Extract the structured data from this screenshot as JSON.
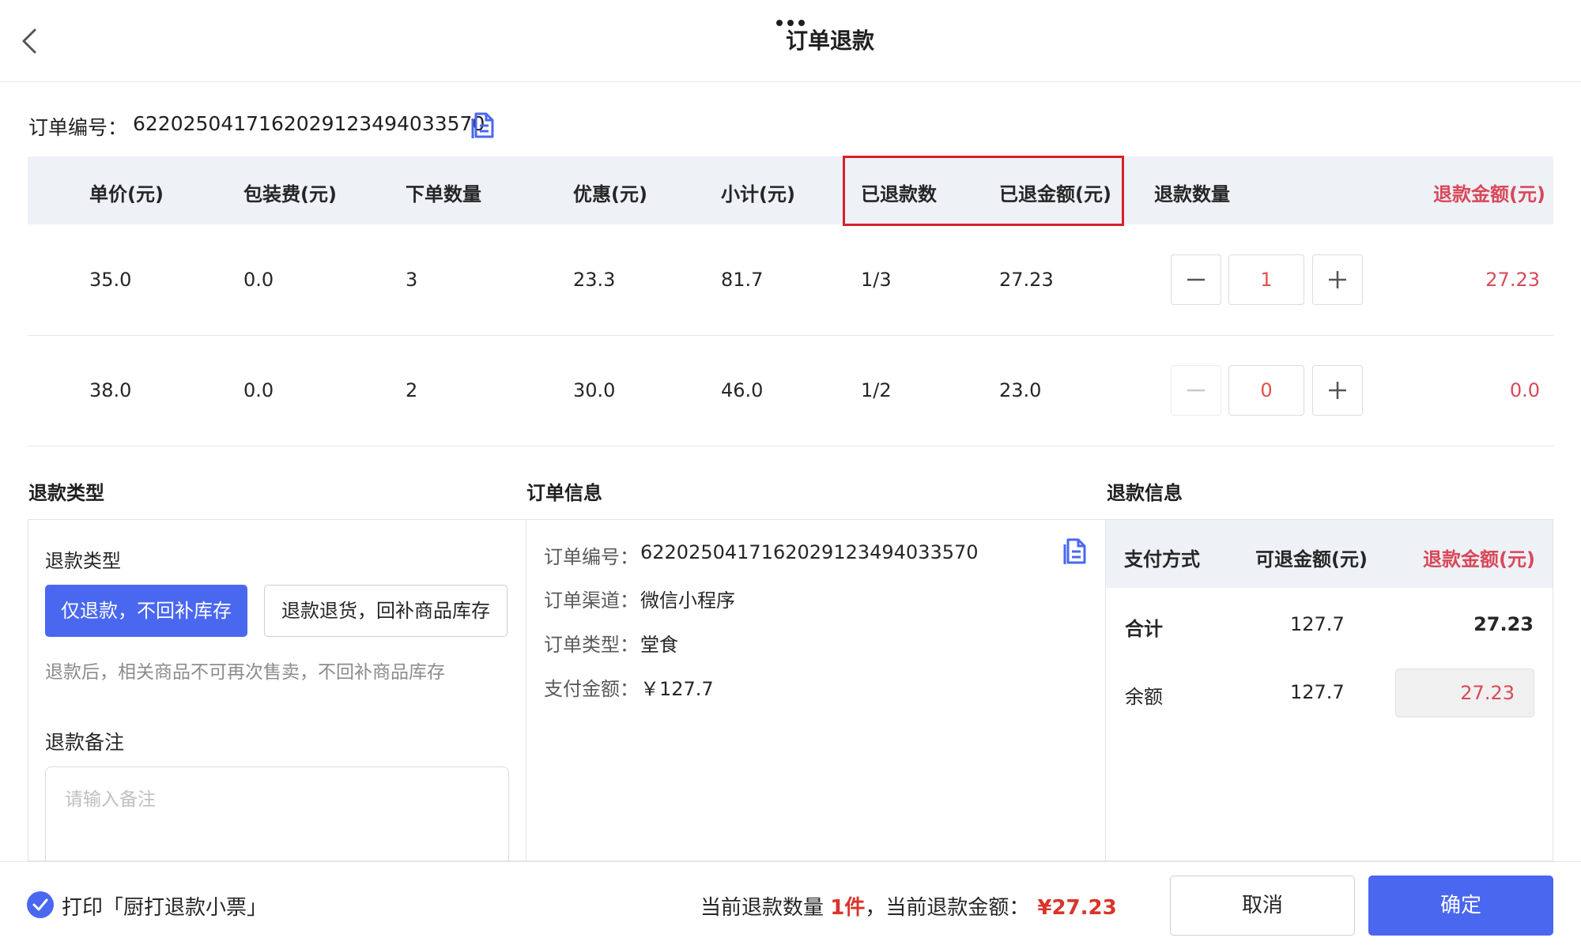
{
  "header": {
    "title": "订单退款"
  },
  "order_no": {
    "label": "订单编号：",
    "value": "6220250417162029123494033570"
  },
  "table": {
    "columns": [
      "单价(元)",
      "包装费(元)",
      "下单数量",
      "优惠(元)",
      "小计(元)",
      "已退款数",
      "已退金额(元)",
      "退款数量",
      "退款金额(元)"
    ],
    "rows": [
      {
        "unit_price": "35.0",
        "packing_fee": "0.0",
        "order_qty": "3",
        "discount": "23.3",
        "subtotal": "81.7",
        "refunded_qty": "1/3",
        "refunded_amount": "27.23",
        "refund_qty": "1",
        "refund_amount": "27.23"
      },
      {
        "unit_price": "38.0",
        "packing_fee": "0.0",
        "order_qty": "2",
        "discount": "30.0",
        "subtotal": "46.0",
        "refunded_qty": "1/2",
        "refunded_amount": "23.0",
        "refund_qty": "0",
        "refund_amount": "0.0"
      }
    ]
  },
  "sections": {
    "refund_type": "退款类型",
    "order_info": "订单信息",
    "refund_info": "退款信息"
  },
  "refund_type": {
    "label": "退款类型",
    "option_refund_only": "仅退款，不回补库存",
    "option_refund_return": "退款退货，回补商品库存",
    "hint": "退款后，相关商品不可再次售卖，不回补商品库存",
    "remark_label": "退款备注",
    "remark_placeholder": "请输入备注"
  },
  "order_info": {
    "order_no_label": "订单编号：",
    "order_no": "6220250417162029123494033570",
    "channel_label": "订单渠道：",
    "channel": "微信小程序",
    "type_label": "订单类型：",
    "type": "堂食",
    "paid_label": "支付金额：",
    "paid": "￥127.7"
  },
  "refund_info": {
    "columns": [
      "支付方式",
      "可退金额(元)",
      "退款金额(元)"
    ],
    "total": {
      "method": "合计",
      "refundable": "127.7",
      "refund": "27.23"
    },
    "balance": {
      "method": "余额",
      "refundable": "127.7",
      "refund": "27.23"
    }
  },
  "footer": {
    "print_label": "打印「厨打退款小票」",
    "summary_prefix": "当前退款数量 ",
    "summary_qty": "1件",
    "summary_middle": "，当前退款金额：",
    "summary_amount": "¥27.23",
    "cancel": "取消",
    "confirm": "确定"
  },
  "colors": {
    "accent": "#4a67f0",
    "highlight_box": "#d8202a",
    "refund_red": "#d9485a"
  }
}
